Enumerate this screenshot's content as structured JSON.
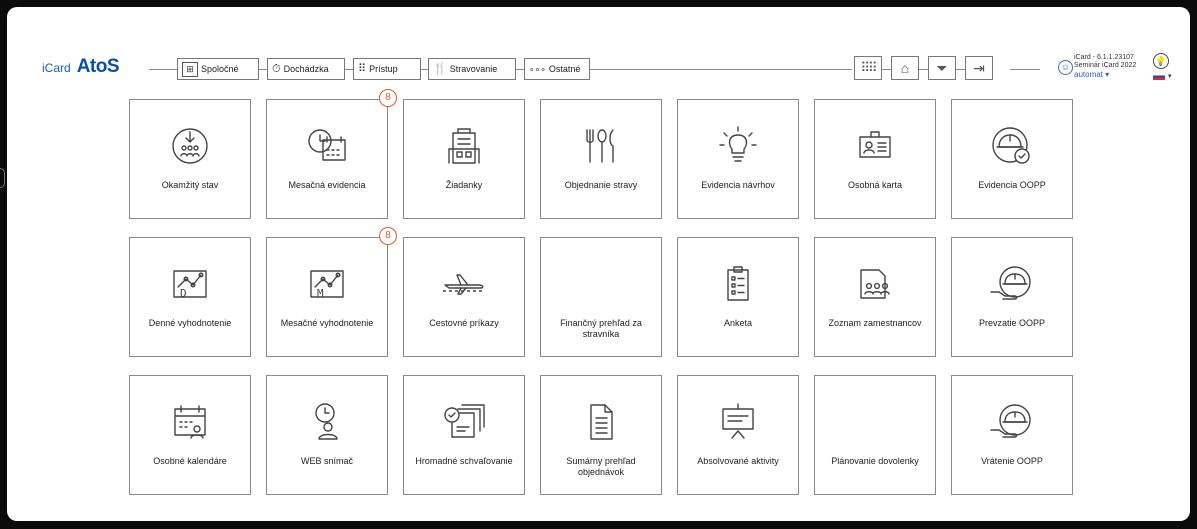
{
  "brand": {
    "icard": "iCard",
    "atos": "AtoS"
  },
  "nav": [
    {
      "label": "Spoločné",
      "icon": "people-grid-icon"
    },
    {
      "label": "Dochádzka",
      "icon": "hand-clock-icon"
    },
    {
      "label": "Prístup",
      "icon": "keypad-icon"
    },
    {
      "label": "Stravovanie",
      "icon": "cutlery-icon"
    },
    {
      "label": "Ostatné",
      "icon": "dots-icon"
    }
  ],
  "toolbar_icons": [
    "grid-icon",
    "home-icon",
    "filter-icon",
    "logout-icon"
  ],
  "userinfo": {
    "version": "iCard - 6.1.1.23107",
    "seminar": "Seminár iCard 2022",
    "user": "automat ▾"
  },
  "tiles": [
    {
      "label": "Okamžitý stav",
      "icon": "download-people-icon"
    },
    {
      "label": "Mesačná evidencia",
      "icon": "clock-calendar-icon",
      "badge": "8"
    },
    {
      "label": "Žiadanky",
      "icon": "building-icon"
    },
    {
      "label": "Objednanie stravy",
      "icon": "cutlery-icon"
    },
    {
      "label": "Evidencia návrhov",
      "icon": "lightbulb-icon"
    },
    {
      "label": "Osobná karta",
      "icon": "id-card-icon"
    },
    {
      "label": "Evidencia OOPP",
      "icon": "helmet-check-icon"
    },
    {
      "label": "Denné vyhodnotenie",
      "icon": "chart-d-icon"
    },
    {
      "label": "Mesačné vyhodnotenie",
      "icon": "chart-m-icon",
      "badge": "8"
    },
    {
      "label": "Cestovné príkazy",
      "icon": "airplane-icon"
    },
    {
      "label": "Finančný prehľad za stravníka",
      "icon": ""
    },
    {
      "label": "Anketa",
      "icon": "checklist-icon"
    },
    {
      "label": "Zoznam zamestnancov",
      "icon": "employee-list-icon"
    },
    {
      "label": "Prevzatie OOPP",
      "icon": "helmet-hand-icon"
    },
    {
      "label": "Osobné kalendáre",
      "icon": "calendar-person-icon"
    },
    {
      "label": "WEB snímač",
      "icon": "clock-person-icon"
    },
    {
      "label": "Hromadné schvaľovanie",
      "icon": "bulk-approve-icon"
    },
    {
      "label": "Sumárny prehľad objednávok",
      "icon": "document-icon"
    },
    {
      "label": "Absolvované aktivity",
      "icon": "presentation-icon"
    },
    {
      "label": "Plánovanie dovolenky",
      "icon": ""
    },
    {
      "label": "Vrátenie OOPP",
      "icon": "helmet-hand-icon"
    }
  ]
}
